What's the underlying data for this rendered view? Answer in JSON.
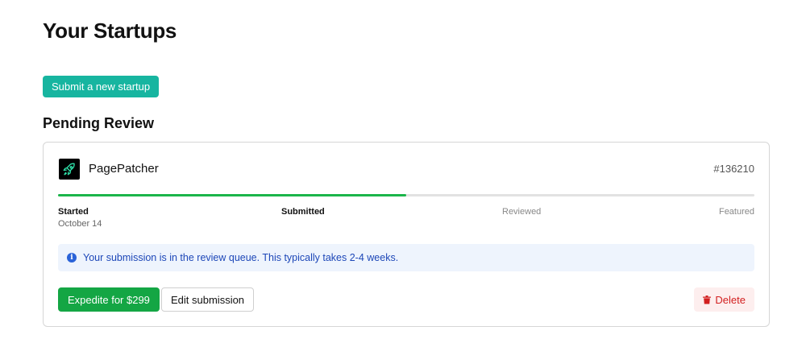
{
  "page": {
    "title": "Your Startups"
  },
  "actions": {
    "submit_label": "Submit a new startup"
  },
  "section": {
    "title": "Pending Review"
  },
  "startup": {
    "name": "PagePatcher",
    "id": "#136210",
    "logo_icon": "rocket-icon",
    "progress_fraction": 0.5,
    "steps": [
      {
        "label": "Started",
        "date": "October 14",
        "state": "complete"
      },
      {
        "label": "Submitted",
        "state": "current"
      },
      {
        "label": "Reviewed",
        "state": "pending"
      },
      {
        "label": "Featured",
        "state": "pending"
      }
    ],
    "info_icon": "info-icon",
    "info_message": "Your submission is in the review queue. This typically takes 2-4 weeks.",
    "buttons": {
      "expedite": "Expedite for $299",
      "edit": "Edit submission",
      "delete": "Delete",
      "delete_icon": "trash-icon"
    }
  },
  "colors": {
    "primary_teal": "#17b5a0",
    "progress_green": "#1bb54a",
    "expedite_green": "#14a644",
    "info_bg": "#eef4fd",
    "info_text": "#1d47b8",
    "delete_bg": "#fdeeee",
    "delete_text": "#d21f1f"
  }
}
